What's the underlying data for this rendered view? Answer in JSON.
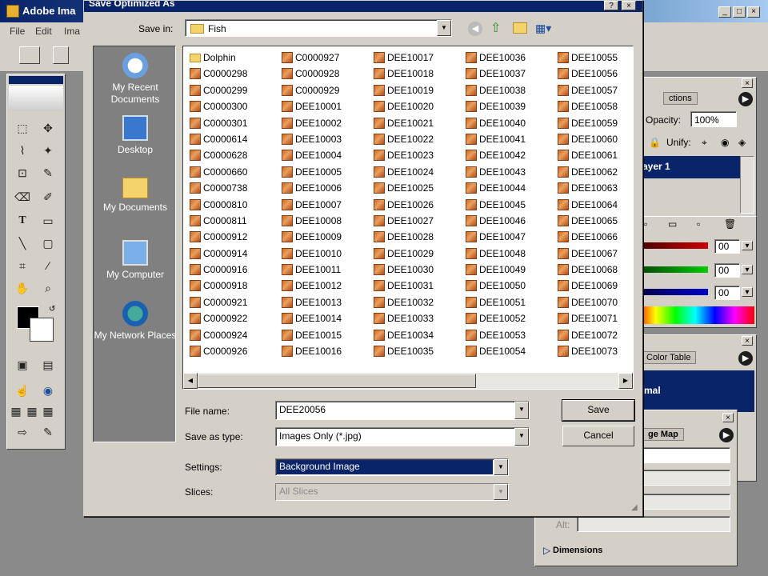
{
  "app": {
    "title": "Adobe Ima",
    "menu": [
      "File",
      "Edit",
      "Ima"
    ]
  },
  "dialog": {
    "title": "Save Optimized As",
    "save_in_label": "Save in:",
    "save_in_value": "Fish",
    "places": [
      "My Recent Documents",
      "Desktop",
      "My Documents",
      "My Computer",
      "My Network Places"
    ],
    "files": [
      [
        "Dolphin",
        "C0000298",
        "C0000299",
        "C0000300",
        "C0000301",
        "C0000614",
        "C0000628",
        "C0000660",
        "C0000738",
        "C0000810",
        "C0000811",
        "C0000912",
        "C0000914",
        "C0000916",
        "C0000918",
        "C0000921",
        "C0000922",
        "C0000924",
        "C0000926"
      ],
      [
        "C0000927",
        "C0000928",
        "C0000929",
        "DEE10001",
        "DEE10002",
        "DEE10003",
        "DEE10004",
        "DEE10005",
        "DEE10006",
        "DEE10007",
        "DEE10008",
        "DEE10009",
        "DEE10010",
        "DEE10011",
        "DEE10012",
        "DEE10013",
        "DEE10014",
        "DEE10015",
        "DEE10016"
      ],
      [
        "DEE10017",
        "DEE10018",
        "DEE10019",
        "DEE10020",
        "DEE10021",
        "DEE10022",
        "DEE10023",
        "DEE10024",
        "DEE10025",
        "DEE10026",
        "DEE10027",
        "DEE10028",
        "DEE10029",
        "DEE10030",
        "DEE10031",
        "DEE10032",
        "DEE10033",
        "DEE10034",
        "DEE10035"
      ],
      [
        "DEE10036",
        "DEE10037",
        "DEE10038",
        "DEE10039",
        "DEE10040",
        "DEE10041",
        "DEE10042",
        "DEE10043",
        "DEE10044",
        "DEE10045",
        "DEE10046",
        "DEE10047",
        "DEE10048",
        "DEE10049",
        "DEE10050",
        "DEE10051",
        "DEE10052",
        "DEE10053",
        "DEE10054"
      ],
      [
        "DEE10055",
        "DEE10056",
        "DEE10057",
        "DEE10058",
        "DEE10059",
        "DEE10060",
        "DEE10061",
        "DEE10062",
        "DEE10063",
        "DEE10064",
        "DEE10065",
        "DEE10066",
        "DEE10067",
        "DEE10068",
        "DEE10069",
        "DEE10070",
        "DEE10071",
        "DEE10072",
        "DEE10073"
      ]
    ],
    "file_name_label": "File name:",
    "file_name_value": "DEE20056",
    "save_as_type_label": "Save as type:",
    "save_as_type_value": "Images Only (*.jpg)",
    "settings_label": "Settings:",
    "settings_value": "Background Image",
    "slices_label": "Slices:",
    "slices_value": "All Slices",
    "save_button": "Save",
    "cancel_button": "Cancel"
  },
  "panels": {
    "layers_tab": "ctions",
    "opacity_label": "Opacity:",
    "opacity_value": "100%",
    "unify_label": "Unify:",
    "layer_name": "ayer 1",
    "color_values": [
      "00",
      "00",
      "00"
    ],
    "color_table_tab": "Color Table",
    "color_table_item": "mal",
    "image_map_tab": "ge Map",
    "alt_label": "Alt:",
    "dimensions_label": "Dimensions"
  },
  "colors": {
    "title_bar": "#0a246a",
    "selection": "#0a246a",
    "dialog_bg": "#d4d0c8",
    "places_bg": "#808080"
  }
}
